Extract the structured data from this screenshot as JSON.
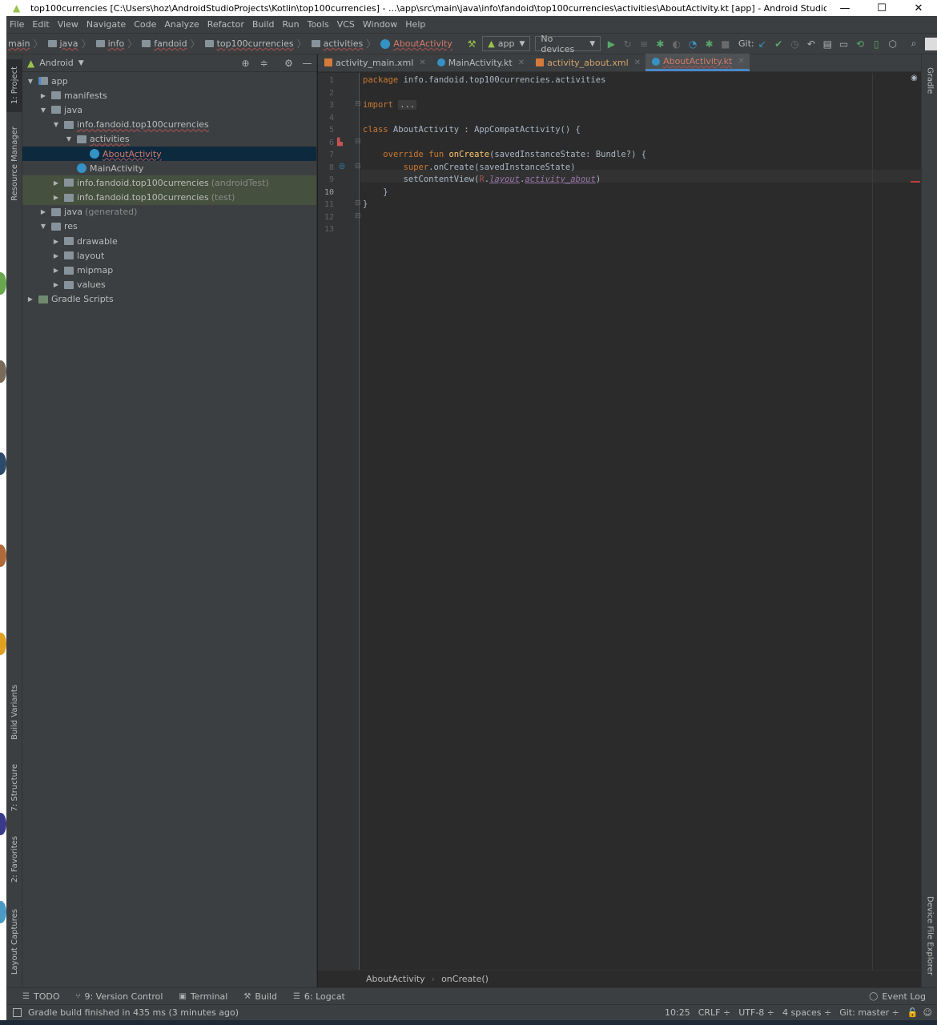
{
  "window": {
    "title": "top100currencies [C:\\Users\\hoz\\AndroidStudioProjects\\Kotlin\\top100currencies] - ...\\app\\src\\main\\java\\info\\fandoid\\top100currencies\\activities\\AboutActivity.kt [app] - Android Studio",
    "minimize": "—",
    "maximize": "☐",
    "close": "✕"
  },
  "menu": [
    "File",
    "Edit",
    "View",
    "Navigate",
    "Code",
    "Analyze",
    "Refactor",
    "Build",
    "Run",
    "Tools",
    "VCS",
    "Window",
    "Help"
  ],
  "breadcrumbs": [
    "main",
    "java",
    "info",
    "fandoid",
    "top100currencies",
    "activities",
    "AboutActivity"
  ],
  "toolbar": {
    "run_config": "app",
    "devices": "No devices",
    "git_label": "Git:"
  },
  "left_stripe": {
    "project": "1: Project",
    "resource_manager": "Resource Manager",
    "build_variants": "Build Variants",
    "structure": "7: Structure",
    "favorites": "2: Favorites",
    "layout_captures": "Layout Captures"
  },
  "right_stripe": {
    "gradle": "Gradle",
    "device_file_explorer": "Device File Explorer"
  },
  "project_panel": {
    "view_mode": "Android",
    "tree": [
      {
        "label": "app",
        "depth": 0,
        "toggle": "▼",
        "icon": "folder-blue",
        "sub": ""
      },
      {
        "label": "manifests",
        "depth": 1,
        "toggle": "▶",
        "icon": "folder",
        "sub": ""
      },
      {
        "label": "java",
        "depth": 1,
        "toggle": "▼",
        "icon": "folder",
        "sub": ""
      },
      {
        "label": "info.fandoid.top100currencies",
        "depth": 2,
        "toggle": "▼",
        "icon": "folder",
        "sub": ""
      },
      {
        "label": "activities",
        "depth": 3,
        "toggle": "▼",
        "icon": "folder",
        "sub": ""
      },
      {
        "label": "AboutActivity",
        "depth": 4,
        "toggle": "",
        "icon": "kt",
        "sub": ""
      },
      {
        "label": "MainActivity",
        "depth": 3,
        "toggle": "",
        "icon": "kt",
        "sub": ""
      },
      {
        "label": "info.fandoid.top100currencies",
        "depth": 2,
        "toggle": "▶",
        "icon": "folder",
        "sub": "(androidTest)"
      },
      {
        "label": "info.fandoid.top100currencies",
        "depth": 2,
        "toggle": "▶",
        "icon": "folder",
        "sub": "(test)"
      },
      {
        "label": "java",
        "depth": 1,
        "toggle": "▶",
        "icon": "folder",
        "sub": "(generated)"
      },
      {
        "label": "res",
        "depth": 1,
        "toggle": "▼",
        "icon": "folder",
        "sub": ""
      },
      {
        "label": "drawable",
        "depth": 2,
        "toggle": "▶",
        "icon": "folder",
        "sub": ""
      },
      {
        "label": "layout",
        "depth": 2,
        "toggle": "▶",
        "icon": "folder",
        "sub": ""
      },
      {
        "label": "mipmap",
        "depth": 2,
        "toggle": "▶",
        "icon": "folder",
        "sub": ""
      },
      {
        "label": "values",
        "depth": 2,
        "toggle": "▶",
        "icon": "folder",
        "sub": ""
      },
      {
        "label": "Gradle Scripts",
        "depth": 0,
        "toggle": "▶",
        "icon": "gradle",
        "sub": ""
      }
    ]
  },
  "tabs": [
    {
      "label": "activity_main.xml",
      "icon": "xml"
    },
    {
      "label": "MainActivity.kt",
      "icon": "kt"
    },
    {
      "label": "activity_about.xml",
      "icon": "xml"
    },
    {
      "label": "AboutActivity.kt",
      "icon": "kt"
    }
  ],
  "editor": {
    "line_numbers": [
      "1",
      "2",
      "3",
      "4",
      "5",
      "6",
      "7",
      "8",
      "9",
      "10",
      "11",
      "12",
      "13"
    ],
    "current_line": "10",
    "code": {
      "l1_kw": "package",
      "l1_rest": " info.fandoid.top100currencies.activities",
      "l3_kw": "import",
      "l3_fold": "...",
      "l6_kw": "class",
      "l6_rest": " AboutActivity : AppCompatActivity() {",
      "l8_kw": "override fun",
      "l8_fn": "onCreate",
      "l8_rest": "(savedInstanceState: Bundle?) {",
      "l9_kw": "super",
      "l9_rest": ".onCreate(savedInstanceState)",
      "l10_a": "setContentView(",
      "l10_r": "R",
      "l10_dot1": ".",
      "l10_layout": "layout",
      "l10_dot2": ".",
      "l10_about": "activity_about",
      "l10_end": ")",
      "l11": "}",
      "l12": "}"
    },
    "crumbs": [
      "AboutActivity",
      "onCreate()"
    ]
  },
  "bottom_tools": [
    {
      "icon": "☰",
      "label": "TODO"
    },
    {
      "icon": "⑂",
      "label": "9: Version Control"
    },
    {
      "icon": "▣",
      "label": "Terminal"
    },
    {
      "icon": "⚒",
      "label": "Build"
    },
    {
      "icon": "☰",
      "label": "6: Logcat"
    }
  ],
  "event_log": "Event Log",
  "status": {
    "message": "Gradle build finished in 435 ms (3 minutes ago)",
    "position": "10:25",
    "line_sep": "CRLF ÷",
    "encoding": "UTF-8 ÷",
    "indent": "4 spaces ÷",
    "git": "Git: master ÷"
  }
}
